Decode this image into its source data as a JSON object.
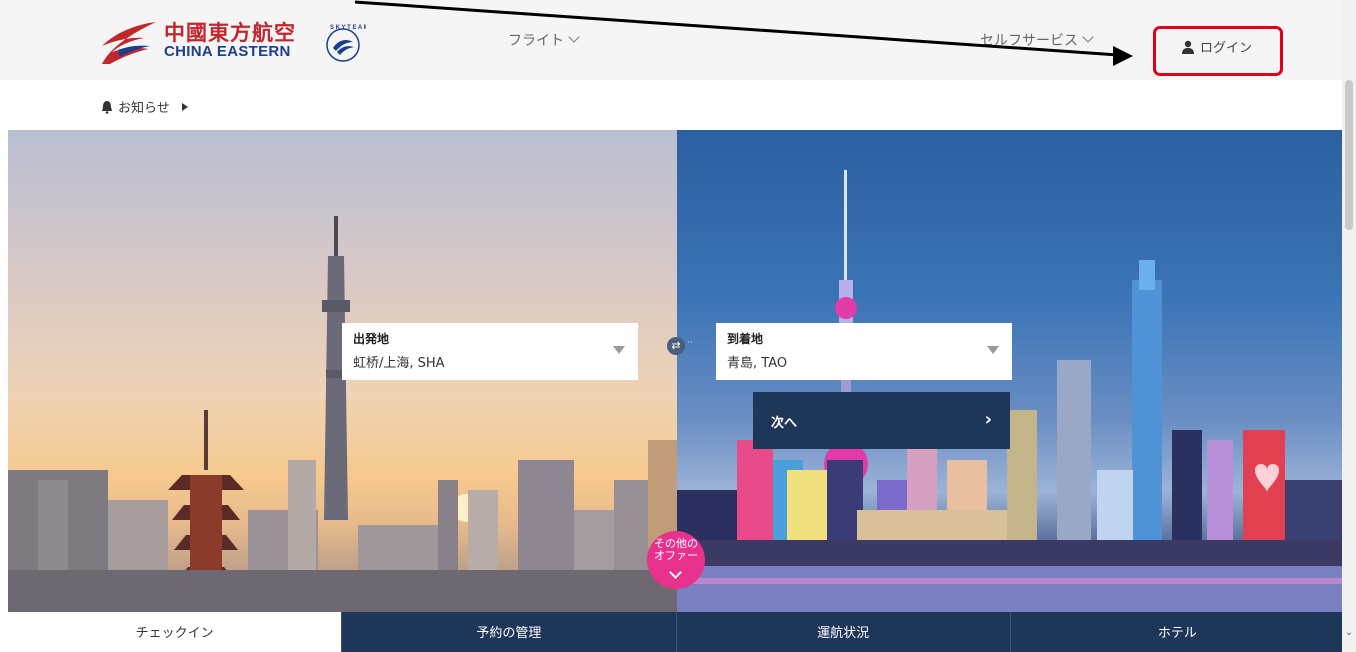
{
  "header": {
    "logo_cn": "中國東方航空",
    "logo_en": "CHINA EASTERN",
    "skyteam_text": "SKYTEAM",
    "nav": [
      {
        "label": "フライト"
      },
      {
        "label": "セルフサービス"
      }
    ],
    "login_label": "ログイン",
    "highlight_color": "#e0001b"
  },
  "notice": {
    "label": "お知らせ"
  },
  "search": {
    "from": {
      "label": "出発地",
      "value": "虹桥/上海, SHA"
    },
    "to": {
      "label": "到着地",
      "value": "青島, TAO"
    },
    "swap_icon": "swap-icon",
    "next_label": "次へ",
    "next_arrow": "›"
  },
  "offer": {
    "line1": "その他の",
    "line2": "オファー"
  },
  "tabs": [
    {
      "label": "チェックイン",
      "active": true
    },
    {
      "label": "予約の管理",
      "active": false
    },
    {
      "label": "運航状況",
      "active": false
    },
    {
      "label": "ホテル",
      "active": false
    }
  ],
  "colors": {
    "brand_red": "#c1272d",
    "brand_blue": "#1b3f8b",
    "navy": "#1e3658",
    "pink": "#e8318d"
  }
}
